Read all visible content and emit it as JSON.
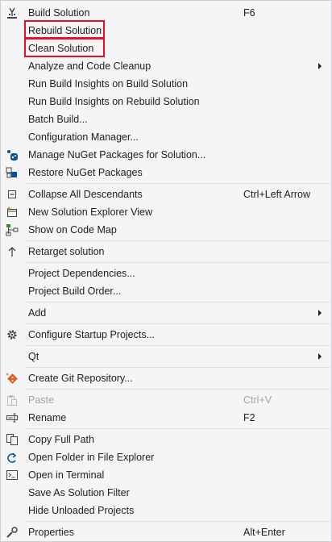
{
  "menu": {
    "items": [
      {
        "label": "Build Solution",
        "shortcut": "F6",
        "icon": "build-icon"
      },
      {
        "label": "Rebuild Solution",
        "highlighted": true
      },
      {
        "label": "Clean Solution",
        "highlighted": true
      },
      {
        "label": "Analyze and Code Cleanup",
        "submenu": true
      },
      {
        "label": "Run Build Insights on Build Solution"
      },
      {
        "label": "Run Build Insights on Rebuild Solution"
      },
      {
        "label": "Batch Build..."
      },
      {
        "label": "Configuration Manager..."
      },
      {
        "label": "Manage NuGet Packages for Solution...",
        "icon": "nuget-icon"
      },
      {
        "label": "Restore NuGet Packages",
        "icon": "restore-packages-icon"
      },
      {
        "label": "Collapse All Descendants",
        "shortcut": "Ctrl+Left Arrow",
        "icon": "collapse-icon"
      },
      {
        "label": "New Solution Explorer View",
        "icon": "new-view-icon"
      },
      {
        "label": "Show on Code Map",
        "icon": "code-map-icon"
      },
      {
        "label": "Retarget solution",
        "icon": "retarget-arrow-icon"
      },
      {
        "label": "Project Dependencies..."
      },
      {
        "label": "Project Build Order..."
      },
      {
        "label": "Add",
        "submenu": true
      },
      {
        "label": "Configure Startup Projects...",
        "icon": "gear-icon"
      },
      {
        "label": "Qt",
        "submenu": true
      },
      {
        "label": "Create Git Repository...",
        "icon": "git-icon"
      },
      {
        "label": "Paste",
        "shortcut": "Ctrl+V",
        "icon": "paste-icon",
        "disabled": true
      },
      {
        "label": "Rename",
        "shortcut": "F2",
        "icon": "rename-icon"
      },
      {
        "label": "Copy Full Path",
        "icon": "copy-icon"
      },
      {
        "label": "Open Folder in File Explorer",
        "icon": "open-folder-icon"
      },
      {
        "label": "Open in Terminal",
        "icon": "terminal-icon"
      },
      {
        "label": "Save As Solution Filter"
      },
      {
        "label": "Hide Unloaded Projects"
      },
      {
        "label": "Properties",
        "shortcut": "Alt+Enter",
        "icon": "wrench-icon"
      }
    ]
  },
  "colors": {
    "menu_background": "#f5f5f5",
    "text": "#1e1e1e",
    "disabled_text": "#a2a4a5",
    "separator": "#e0e0e0",
    "highlight_box": "#e8112d"
  }
}
